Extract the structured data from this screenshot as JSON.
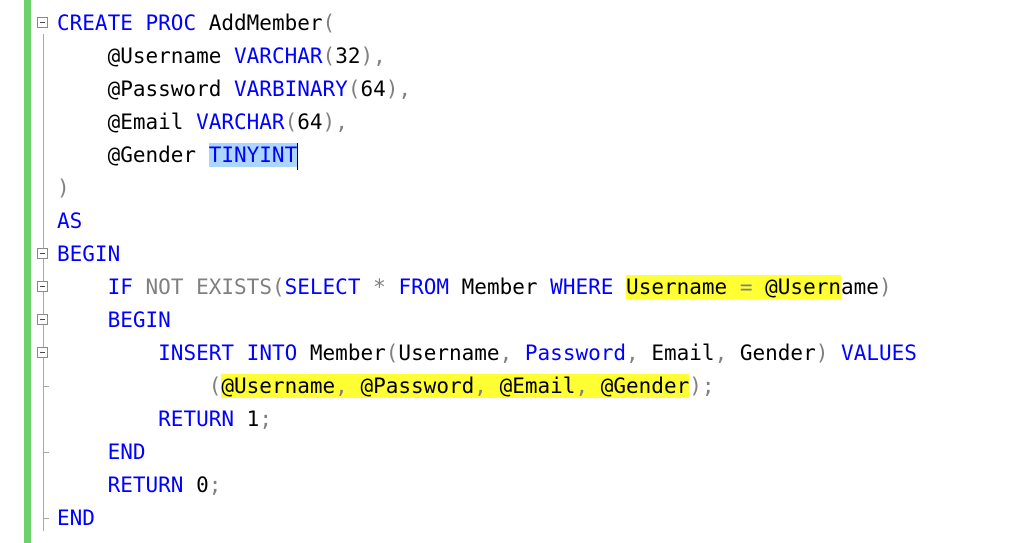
{
  "editor": {
    "lines": [
      {
        "fold": "collapse",
        "tokens": [
          {
            "c": "kw",
            "t": "CREATE"
          },
          {
            "c": "tx",
            "t": " "
          },
          {
            "c": "kw",
            "t": "PROC"
          },
          {
            "c": "tx",
            "t": " AddMember"
          },
          {
            "c": "gr",
            "t": "("
          }
        ]
      },
      {
        "fold": "",
        "tokens": [
          {
            "c": "tx",
            "t": "    @Username "
          },
          {
            "c": "kw",
            "t": "VARCHAR"
          },
          {
            "c": "gr",
            "t": "("
          },
          {
            "c": "tx",
            "t": "32"
          },
          {
            "c": "gr",
            "t": "),"
          }
        ]
      },
      {
        "fold": "",
        "tokens": [
          {
            "c": "tx",
            "t": "    @Password "
          },
          {
            "c": "kw",
            "t": "VARBINARY"
          },
          {
            "c": "gr",
            "t": "("
          },
          {
            "c": "tx",
            "t": "64"
          },
          {
            "c": "gr",
            "t": "),"
          }
        ]
      },
      {
        "fold": "",
        "tokens": [
          {
            "c": "tx",
            "t": "    @Email "
          },
          {
            "c": "kw",
            "t": "VARCHAR"
          },
          {
            "c": "gr",
            "t": "("
          },
          {
            "c": "tx",
            "t": "64"
          },
          {
            "c": "gr",
            "t": "),"
          }
        ]
      },
      {
        "fold": "",
        "tokens": [
          {
            "c": "tx",
            "t": "    @Gender "
          },
          {
            "c": "kw sel",
            "t": "TINYINT"
          },
          {
            "c": "cursor",
            "t": ""
          }
        ]
      },
      {
        "fold": "",
        "tokens": [
          {
            "c": "gr",
            "t": ")"
          }
        ]
      },
      {
        "fold": "",
        "tokens": [
          {
            "c": "kw",
            "t": "AS"
          }
        ]
      },
      {
        "fold": "collapse",
        "tokens": [
          {
            "c": "kw",
            "t": "BEGIN"
          }
        ]
      },
      {
        "fold": "collapse",
        "tokens": [
          {
            "c": "tx",
            "t": "    "
          },
          {
            "c": "kw",
            "t": "IF"
          },
          {
            "c": "tx",
            "t": " "
          },
          {
            "c": "gr",
            "t": "NOT EXISTS("
          },
          {
            "c": "kw",
            "t": "SELECT"
          },
          {
            "c": "tx",
            "t": " "
          },
          {
            "c": "gr",
            "t": "*"
          },
          {
            "c": "tx",
            "t": " "
          },
          {
            "c": "kw",
            "t": "FROM"
          },
          {
            "c": "tx",
            "t": " Member "
          },
          {
            "c": "kw",
            "t": "WHERE"
          },
          {
            "c": "tx",
            "t": " "
          },
          {
            "c": "tx hl",
            "t": "Username "
          },
          {
            "c": "gr hl",
            "t": "="
          },
          {
            "c": "tx hl",
            "t": " @Usern"
          },
          {
            "c": "tx",
            "t": "ame"
          },
          {
            "c": "gr",
            "t": ")"
          }
        ]
      },
      {
        "fold": "collapse",
        "tokens": [
          {
            "c": "tx",
            "t": "    "
          },
          {
            "c": "kw",
            "t": "BEGIN"
          }
        ]
      },
      {
        "fold": "collapse",
        "tokens": [
          {
            "c": "tx",
            "t": "        "
          },
          {
            "c": "kw",
            "t": "INSERT"
          },
          {
            "c": "tx",
            "t": " "
          },
          {
            "c": "kw",
            "t": "INTO"
          },
          {
            "c": "tx",
            "t": " Member"
          },
          {
            "c": "gr",
            "t": "("
          },
          {
            "c": "tx",
            "t": "Username"
          },
          {
            "c": "gr",
            "t": ","
          },
          {
            "c": "tx",
            "t": " "
          },
          {
            "c": "kw",
            "t": "Password"
          },
          {
            "c": "gr",
            "t": ","
          },
          {
            "c": "tx",
            "t": " Email"
          },
          {
            "c": "gr",
            "t": ","
          },
          {
            "c": "tx",
            "t": " Gender"
          },
          {
            "c": "gr",
            "t": ")"
          },
          {
            "c": "tx",
            "t": " "
          },
          {
            "c": "kw",
            "t": "VALUES"
          }
        ]
      },
      {
        "fold": "tick",
        "tokens": [
          {
            "c": "tx",
            "t": "            "
          },
          {
            "c": "gr",
            "t": "("
          },
          {
            "c": "tx hl",
            "t": "@Username"
          },
          {
            "c": "gr hl",
            "t": ","
          },
          {
            "c": "tx hl",
            "t": " @Password"
          },
          {
            "c": "gr hl",
            "t": ","
          },
          {
            "c": "tx hl",
            "t": " @Email"
          },
          {
            "c": "gr hl",
            "t": ","
          },
          {
            "c": "tx hl",
            "t": " @Gender"
          },
          {
            "c": "gr",
            "t": ");"
          }
        ]
      },
      {
        "fold": "",
        "tokens": [
          {
            "c": "tx",
            "t": "        "
          },
          {
            "c": "kw",
            "t": "RETURN"
          },
          {
            "c": "tx",
            "t": " 1"
          },
          {
            "c": "gr",
            "t": ";"
          }
        ]
      },
      {
        "fold": "tick",
        "tokens": [
          {
            "c": "tx",
            "t": "    "
          },
          {
            "c": "kw",
            "t": "END"
          }
        ]
      },
      {
        "fold": "",
        "tokens": [
          {
            "c": "tx",
            "t": "    "
          },
          {
            "c": "kw",
            "t": "RETURN"
          },
          {
            "c": "tx",
            "t": " 0"
          },
          {
            "c": "gr",
            "t": ";"
          }
        ]
      },
      {
        "fold": "tick",
        "tokens": [
          {
            "c": "kw",
            "t": "END"
          }
        ]
      }
    ]
  }
}
